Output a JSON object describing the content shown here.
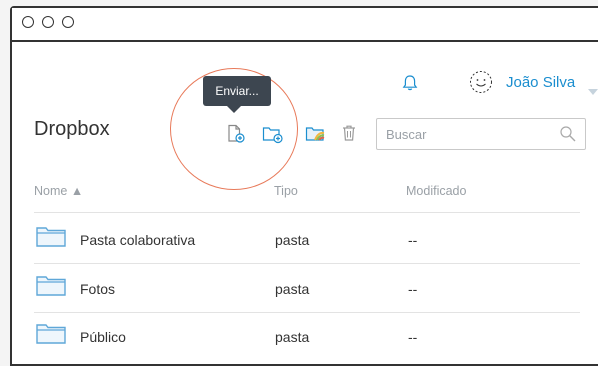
{
  "app": {
    "title": "Dropbox"
  },
  "user": {
    "name": "João Silva"
  },
  "toolbar": {
    "tooltip": "Enviar...",
    "icons": [
      "upload-file-icon",
      "new-folder-icon",
      "shared-folder-icon",
      "trash-icon"
    ]
  },
  "search": {
    "placeholder": "Buscar",
    "value": ""
  },
  "table": {
    "headers": {
      "name": "Nome ▲",
      "type": "Tipo",
      "modified": "Modificado"
    },
    "rows": [
      {
        "name": "Pasta colaborativa",
        "type": "pasta",
        "modified": "--"
      },
      {
        "name": "Fotos",
        "type": "pasta",
        "modified": "--"
      },
      {
        "name": "Público",
        "type": "pasta",
        "modified": "--"
      }
    ]
  },
  "colors": {
    "accent": "#1b8ecf",
    "tooltip_bg": "#3d4650",
    "highlight": "#e87a5a",
    "folder": "#5fa7d8"
  }
}
